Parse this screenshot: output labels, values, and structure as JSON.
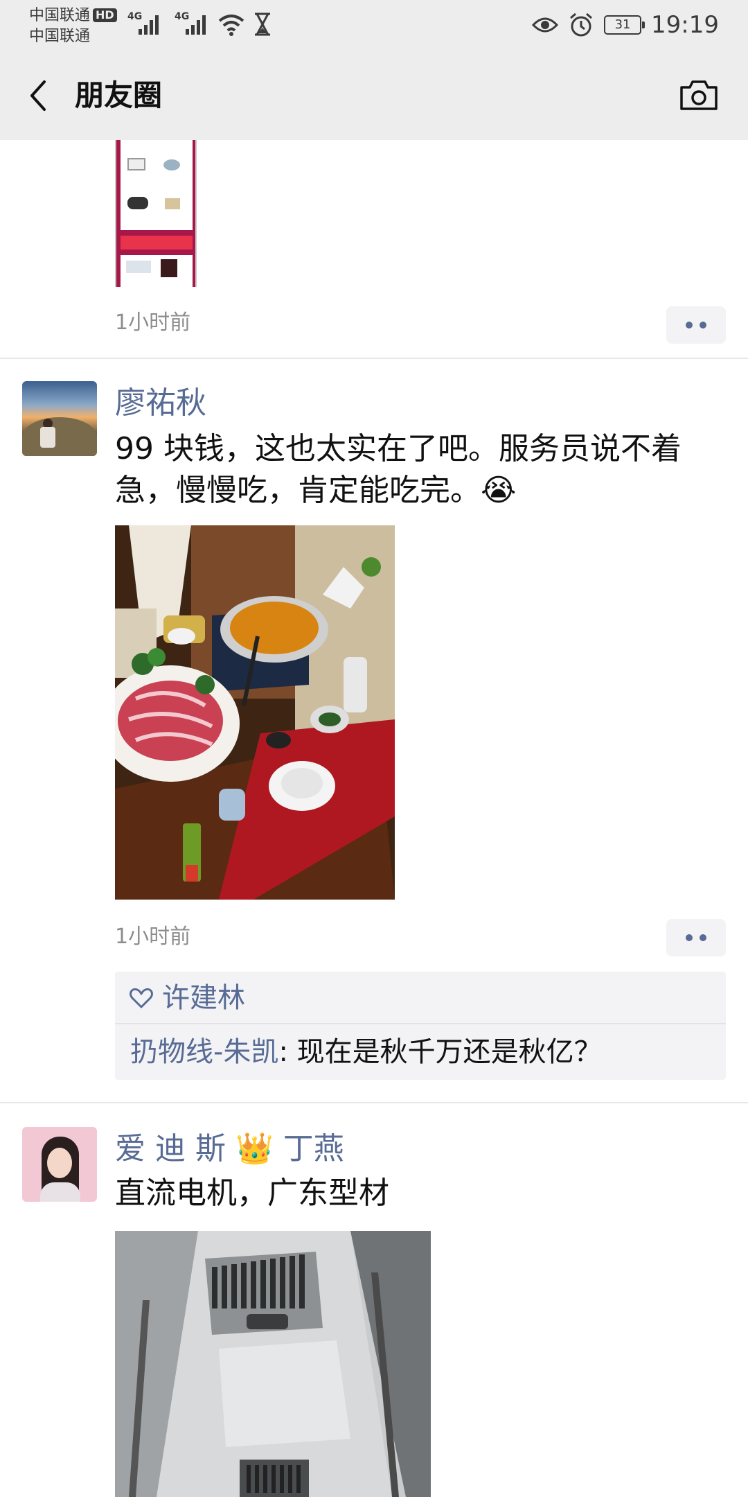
{
  "status_bar": {
    "carrier_1": "中国联通",
    "hd_badge": "HD",
    "carrier_2": "中国联通",
    "network_1": "4G",
    "network_2": "4G",
    "battery": "31",
    "time": "19:19"
  },
  "header": {
    "title": "朋友圈"
  },
  "posts": [
    {
      "time": "1小时前"
    },
    {
      "name": "廖祐秋",
      "text": "99 块钱，这也太实在了吧。服务员说不着急，慢慢吃，肯定能吃完。😭",
      "time": "1小时前",
      "likes": "许建林",
      "comment_author": "扔物线-朱凯",
      "comment_text": ": 现在是秋千万还是秋亿？"
    },
    {
      "name": "爱 迪 斯 👑 丁燕",
      "text": "直流电机，广东型材"
    }
  ]
}
